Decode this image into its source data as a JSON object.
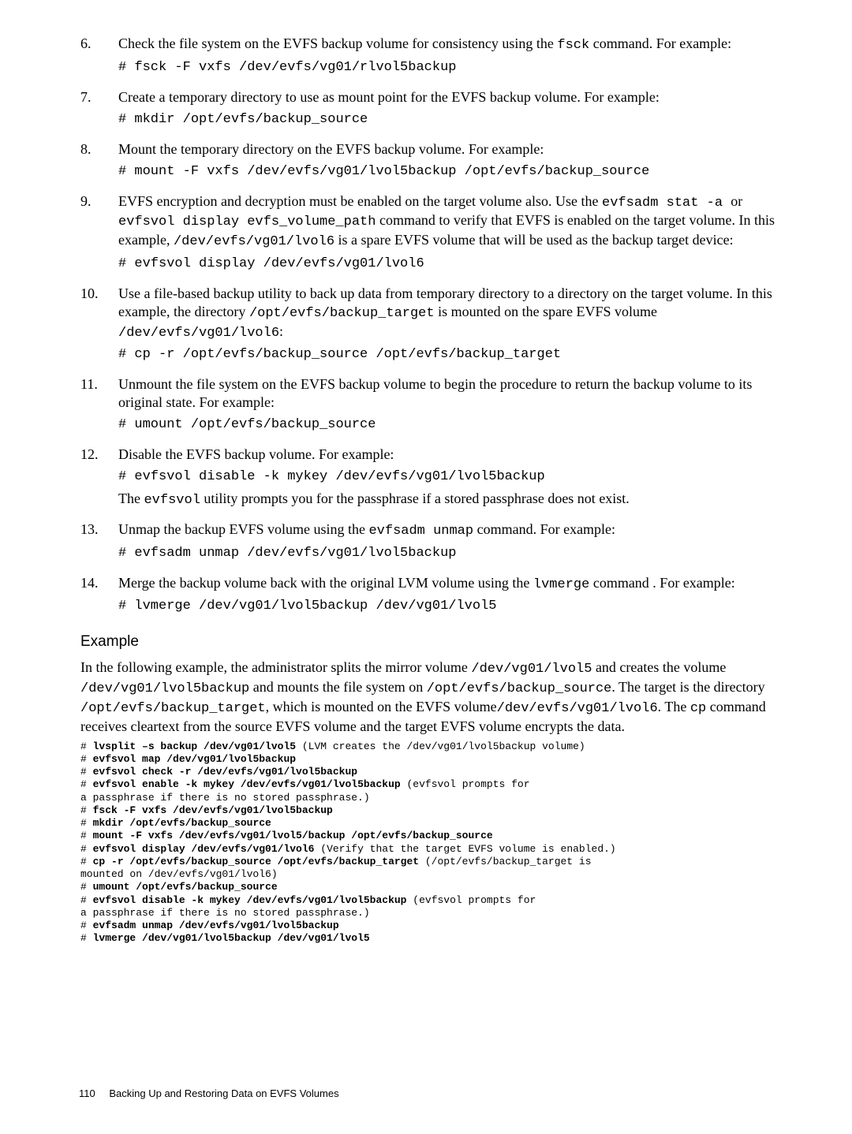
{
  "steps": [
    {
      "n": 6,
      "lines": [
        {
          "t": "mixed",
          "parts": [
            {
              "txt": "Check the file system on the EVFS backup volume for consistency using the "
            },
            {
              "code": "fsck"
            },
            {
              "txt": " command. For example:"
            }
          ]
        },
        {
          "t": "cmd",
          "txt": "# fsck -F vxfs /dev/evfs/vg01/rlvol5backup"
        }
      ]
    },
    {
      "n": 7,
      "lines": [
        {
          "t": "mixed",
          "parts": [
            {
              "txt": "Create a temporary directory to use as mount point for the EVFS backup volume. For example:"
            }
          ]
        },
        {
          "t": "cmd",
          "txt": "# mkdir /opt/evfs/backup_source"
        }
      ]
    },
    {
      "n": 8,
      "lines": [
        {
          "t": "mixed",
          "parts": [
            {
              "txt": "Mount the temporary directory on the EVFS backup volume. For example:"
            }
          ]
        },
        {
          "t": "cmd",
          "txt": "# mount -F vxfs /dev/evfs/vg01/lvol5backup /opt/evfs/backup_source"
        }
      ]
    },
    {
      "n": 9,
      "lines": [
        {
          "t": "mixed",
          "parts": [
            {
              "txt": "EVFS encryption and decryption must be enabled on the target volume also. Use the "
            },
            {
              "code": "evfsadm stat -a "
            },
            {
              "txt": " or "
            },
            {
              "code": "evfsvol display evfs_volume_path"
            },
            {
              "txt": " command to verify that EVFS is enabled on the target volume. In this example, "
            },
            {
              "code": "/dev/evfs/vg01/lvol6"
            },
            {
              "txt": " is a spare EVFS volume that will be used as the backup target device:"
            }
          ]
        },
        {
          "t": "cmd",
          "txt": "# evfsvol display /dev/evfs/vg01/lvol6"
        }
      ]
    },
    {
      "n": 10,
      "lines": [
        {
          "t": "mixed",
          "parts": [
            {
              "txt": "Use a file-based backup utility to back up data from temporary directory to a directory on the target volume. In this example, the directory "
            },
            {
              "code": "/opt/evfs/backup_target"
            },
            {
              "txt": " is mounted on the spare EVFS volume "
            },
            {
              "code": "/dev/evfs/vg01/lvol6"
            },
            {
              "txt": ":"
            }
          ]
        },
        {
          "t": "cmd",
          "txt": "# cp -r /opt/evfs/backup_source /opt/evfs/backup_target"
        }
      ]
    },
    {
      "n": 11,
      "lines": [
        {
          "t": "mixed",
          "parts": [
            {
              "txt": "Unmount the file system on the EVFS backup volume to begin the procedure to return the backup volume to its original state. For example:"
            }
          ]
        },
        {
          "t": "cmd",
          "txt": "# umount /opt/evfs/backup_source"
        }
      ]
    },
    {
      "n": 12,
      "lines": [
        {
          "t": "mixed",
          "parts": [
            {
              "txt": "Disable the EVFS backup volume. For example:"
            }
          ]
        },
        {
          "t": "cmd",
          "txt": "# evfsvol disable -k mykey /dev/evfs/vg01/lvol5backup"
        },
        {
          "t": "mixed",
          "parts": [
            {
              "txt": "The "
            },
            {
              "code": "evfsvol"
            },
            {
              "txt": " utility prompts you for the passphrase if a stored passphrase does not exist."
            }
          ]
        }
      ]
    },
    {
      "n": 13,
      "lines": [
        {
          "t": "mixed",
          "parts": [
            {
              "txt": "Unmap the backup EVFS volume using the "
            },
            {
              "code": "evfsadm unmap"
            },
            {
              "txt": " command. For example:"
            }
          ]
        },
        {
          "t": "cmd",
          "txt": "# evfsadm unmap /dev/evfs/vg01/lvol5backup"
        }
      ]
    },
    {
      "n": 14,
      "lines": [
        {
          "t": "mixed",
          "parts": [
            {
              "txt": "Merge the backup volume back with the original LVM volume using the "
            },
            {
              "code": "lvmerge"
            },
            {
              "txt": " command . For example:"
            }
          ]
        },
        {
          "t": "cmd",
          "txt": "# lvmerge /dev/vg01/lvol5backup /dev/vg01/lvol5"
        }
      ]
    }
  ],
  "example": {
    "heading": "Example",
    "para_parts": [
      {
        "txt": "In the following example, the administrator splits the mirror volume "
      },
      {
        "code": "/dev/vg01/lvol5"
      },
      {
        "txt": " and creates the volume "
      },
      {
        "code": "/dev/vg01/lvol5backup"
      },
      {
        "txt": " and mounts the file system on "
      },
      {
        "code": "/opt/evfs/backup_source"
      },
      {
        "txt": ". The target is the directory "
      },
      {
        "code": "/opt/evfs/backup_target"
      },
      {
        "txt": ", which is mounted on the EVFS volume"
      },
      {
        "code": "/dev/evfs/vg01/lvol6"
      },
      {
        "txt": ". The "
      },
      {
        "code": "cp"
      },
      {
        "txt": " command receives cleartext from the source EVFS volume and the target EVFS volume encrypts the data."
      }
    ],
    "block": [
      {
        "b": "# ",
        "bold": "lvsplit –s backup /dev/vg01/lvol5",
        "rest": " (LVM creates the /dev/vg01/lvol5backup volume)"
      },
      {
        "b": "# ",
        "bold": "evfsvol map /dev/vg01/lvol5backup",
        "rest": ""
      },
      {
        "b": "# ",
        "bold": "evfsvol check -r /dev/evfs/vg01/lvol5backup",
        "rest": ""
      },
      {
        "b": "# ",
        "bold": "evfsvol enable -k mykey /dev/evfs/vg01/lvol5backup",
        "rest": " (evfsvol prompts for"
      },
      {
        "b": "",
        "bold": "",
        "rest": "a passphrase if there is no stored passphrase.)"
      },
      {
        "b": "# ",
        "bold": "fsck -F vxfs /dev/evfs/vg01/lvol5backup",
        "rest": ""
      },
      {
        "b": "# ",
        "bold": "mkdir /opt/evfs/backup_source",
        "rest": ""
      },
      {
        "b": "# ",
        "bold": "mount -F vxfs /dev/evfs/vg01/lvol5/backup /opt/evfs/backup_source",
        "rest": ""
      },
      {
        "b": "# ",
        "bold": "evfsvol display /dev/evfs/vg01/lvol6",
        "rest": " (Verify that the target EVFS volume is enabled.)"
      },
      {
        "b": "# ",
        "bold": "cp -r /opt/evfs/backup_source /opt/evfs/backup_target",
        "rest": " (/opt/evfs/backup_target is"
      },
      {
        "b": "",
        "bold": "",
        "rest": "mounted on /dev/evfs/vg01/lvol6)"
      },
      {
        "b": "# ",
        "bold": "umount /opt/evfs/backup_source",
        "rest": ""
      },
      {
        "b": "# ",
        "bold": "evfsvol disable -k mykey /dev/evfs/vg01/lvol5backup",
        "rest": " (evfsvol prompts for"
      },
      {
        "b": "",
        "bold": "",
        "rest": "a passphrase if there is no stored passphrase.)"
      },
      {
        "b": "# ",
        "bold": "evfsadm unmap /dev/evfs/vg01/lvol5backup",
        "rest": ""
      },
      {
        "b": "# ",
        "bold": "lvmerge /dev/vg01/lvol5backup /dev/vg01/lvol5",
        "rest": ""
      }
    ]
  },
  "footer": {
    "page": "110",
    "title": "Backing Up and Restoring Data on EVFS Volumes"
  }
}
